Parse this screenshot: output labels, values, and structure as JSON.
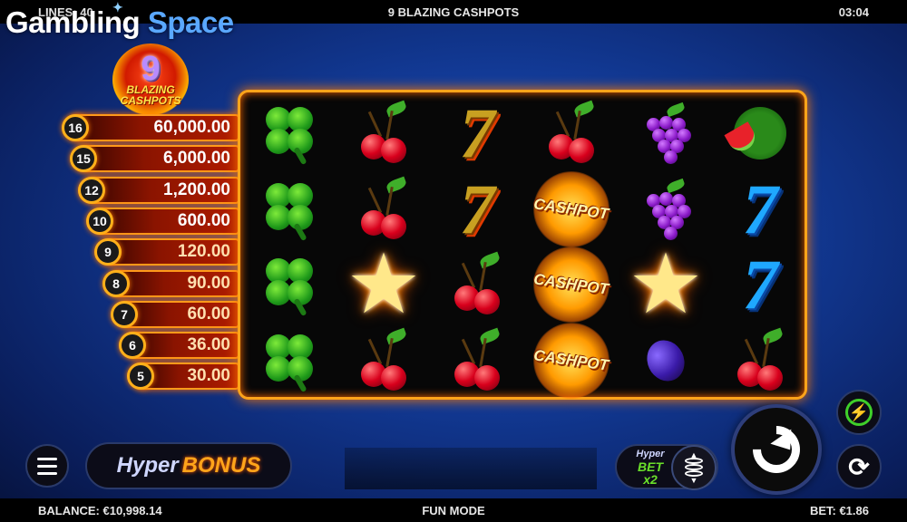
{
  "top": {
    "lines": "LINES: 40",
    "title": "9 BLAZING CASHPOTS",
    "time": "03:04"
  },
  "watermark": {
    "part1": "Gambling",
    "part2": "Space",
    "star": "✦"
  },
  "logo": {
    "number": "9",
    "line1": "BLAZING",
    "line2": "CASHPOTS"
  },
  "paytable": [
    {
      "count": "16",
      "value": "60,000.00"
    },
    {
      "count": "15",
      "value": "6,000.00"
    },
    {
      "count": "12",
      "value": "1,200.00"
    },
    {
      "count": "10",
      "value": "600.00"
    },
    {
      "count": "9",
      "value": "120.00"
    },
    {
      "count": "8",
      "value": "90.00"
    },
    {
      "count": "7",
      "value": "60.00"
    },
    {
      "count": "6",
      "value": "36.00"
    },
    {
      "count": "5",
      "value": "30.00"
    }
  ],
  "reels": [
    [
      "clover",
      "cherry",
      "seven-gold",
      "cherry",
      "grapes",
      "watermelon"
    ],
    [
      "clover",
      "cherry",
      "seven-gold",
      "cashpot",
      "grapes",
      "seven-blue"
    ],
    [
      "clover",
      "star",
      "cherry",
      "cashpot",
      "star",
      "seven-blue"
    ],
    [
      "clover",
      "cherry",
      "cherry",
      "cashpot",
      "plum",
      "cherry"
    ]
  ],
  "symbols": {
    "seven": "7",
    "star": "★",
    "cashpot": "CASHPOT"
  },
  "controls": {
    "hyper_word": "Hyper",
    "bonus_word": "BONUS",
    "hyperbet_line1": "Hyper",
    "hyperbet_line2": "BET",
    "hyperbet_line3": "x2",
    "turbo_icon": "⚡",
    "autoplay_icon": "⟳"
  },
  "bottom": {
    "balance": "BALANCE: €10,998.14",
    "mode": "FUN MODE",
    "bet": "BET: €1.86"
  },
  "colors": {
    "accent": "#ffa41a",
    "background": "#123a96",
    "turbo": "#3fd02a"
  }
}
